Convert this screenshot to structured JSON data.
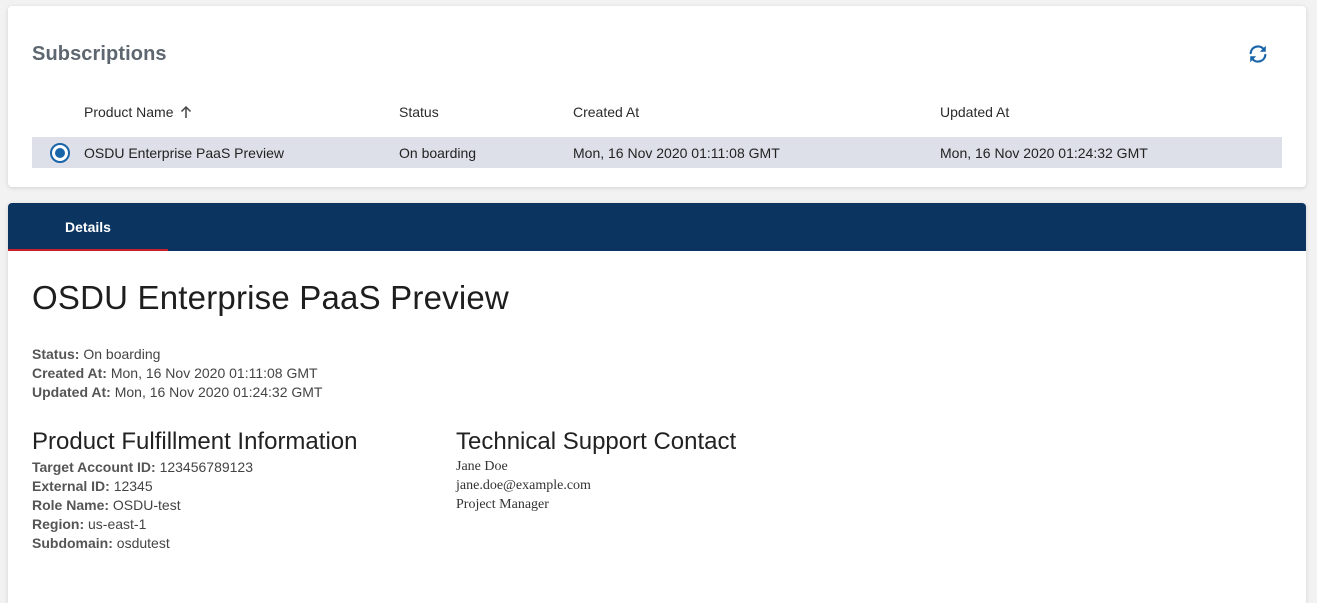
{
  "subscriptions": {
    "title": "Subscriptions",
    "refresh_icon": "refresh-icon",
    "columns": {
      "product_name": "Product Name",
      "status": "Status",
      "created_at": "Created At",
      "updated_at": "Updated At"
    },
    "sort_icon": "arrow-up-icon",
    "rows": [
      {
        "product_name": "OSDU Enterprise PaaS Preview",
        "status": "On boarding",
        "created_at": "Mon, 16 Nov 2020 01:11:08 GMT",
        "updated_at": "Mon, 16 Nov 2020 01:24:32 GMT",
        "selected": true
      }
    ]
  },
  "details": {
    "tab_label": "Details",
    "product_title": "OSDU Enterprise PaaS Preview",
    "status_label": "Status:",
    "status_value": "On boarding",
    "created_label": "Created At:",
    "created_value": "Mon, 16 Nov 2020 01:11:08 GMT",
    "updated_label": "Updated At:",
    "updated_value": "Mon, 16 Nov 2020 01:24:32 GMT",
    "fulfillment": {
      "title": "Product Fulfillment Information",
      "items": [
        {
          "label": "Target Account ID:",
          "value": "123456789123"
        },
        {
          "label": "External ID:",
          "value": "12345"
        },
        {
          "label": "Role Name:",
          "value": "OSDU-test"
        },
        {
          "label": "Region:",
          "value": "us-east-1"
        },
        {
          "label": "Subdomain:",
          "value": "osdutest"
        }
      ]
    },
    "support": {
      "title": "Technical Support Contact",
      "name": "Jane Doe",
      "email": "jane.doe@example.com",
      "role": "Project Manager"
    }
  },
  "colors": {
    "tab_bar": "#0b3460",
    "tab_indicator": "#c8202a",
    "selected_row": "#dde0e8",
    "radio": "#1864a8",
    "refresh_icon": "#1864a8"
  }
}
